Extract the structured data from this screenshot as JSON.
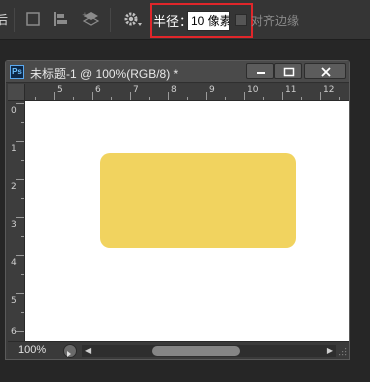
{
  "options_bar": {
    "cut_text": "后",
    "radius_label": "半径：",
    "radius_value": "10 像素",
    "align_edges_label": "对齐边缘",
    "align_edges_checked": false
  },
  "document": {
    "ps_badge": "Ps",
    "title": "未标题-1 @ 100%(RGB/8) *",
    "ruler_h_labels": [
      "5",
      "6",
      "7",
      "8",
      "9",
      "10",
      "11",
      "12"
    ],
    "ruler_v_labels": [
      "0",
      "1",
      "2",
      "3",
      "4",
      "5",
      "6"
    ],
    "shape_color": "#f1d35f"
  },
  "status": {
    "zoom": "100%"
  }
}
